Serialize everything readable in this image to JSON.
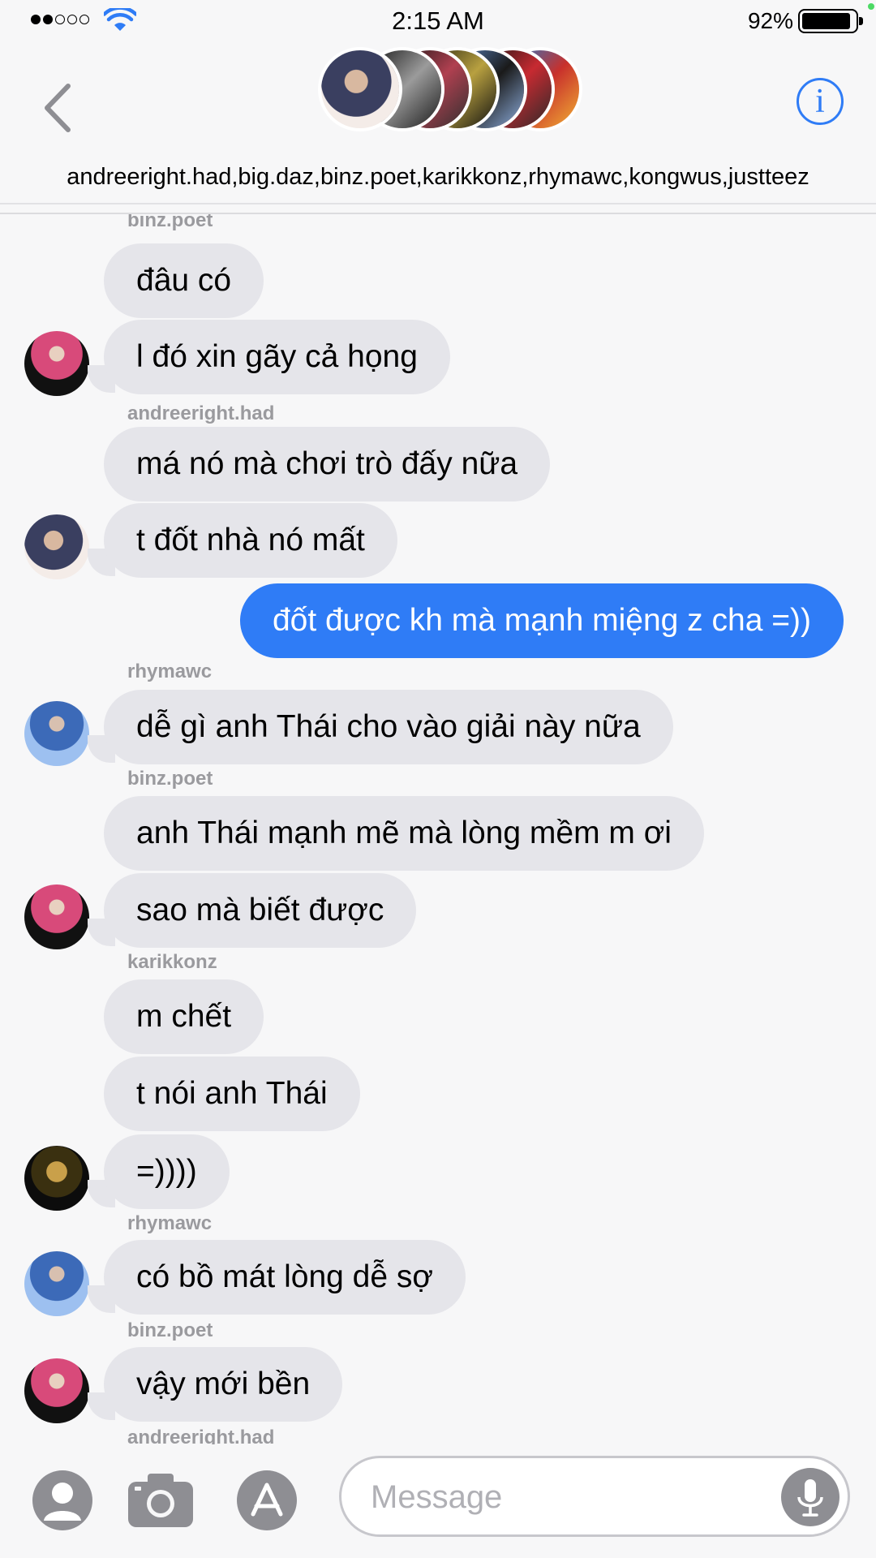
{
  "status_bar": {
    "time": "2:15 AM",
    "battery": "92%"
  },
  "header": {
    "participants": "andreeright.had,big.daz,binz.poet,karikkonz,rhymawc,kongwus,justteez"
  },
  "colors": {
    "accent": "#2f7cf6",
    "incoming_bubble": "#e5e5ea",
    "outgoing_bubble": "#2f7cf6"
  },
  "messages": [
    {
      "sender": "binz.poet",
      "text": "đâu có"
    },
    {
      "text": "l đó xin gãy cả họng"
    },
    {
      "sender": "andreeright.had",
      "text": "má nó mà chơi trò đấy nữa"
    },
    {
      "text": "t đốt nhà nó mất"
    },
    {
      "text": "đốt được kh mà mạnh miệng z cha =))"
    },
    {
      "sender": "rhymawc",
      "text": "dễ gì anh Thái cho vào giải này nữa"
    },
    {
      "sender": "binz.poet",
      "text": "anh Thái mạnh mẽ mà lòng mềm m ơi"
    },
    {
      "text": "sao mà biết được"
    },
    {
      "sender": "karikkonz",
      "text": "m chết"
    },
    {
      "text": "t nói anh Thái"
    },
    {
      "text": "=))))"
    },
    {
      "sender": "rhymawc",
      "text": "có bồ mát lòng dễ sợ"
    },
    {
      "sender": "binz.poet",
      "text": "vậy mới bền"
    },
    {
      "sender": "andreeright.had"
    }
  ],
  "input": {
    "placeholder": "Message"
  },
  "icons": [
    "back-chevron-icon",
    "info-icon",
    "contact-icon",
    "camera-icon",
    "app-store-icon",
    "microphone-icon"
  ]
}
